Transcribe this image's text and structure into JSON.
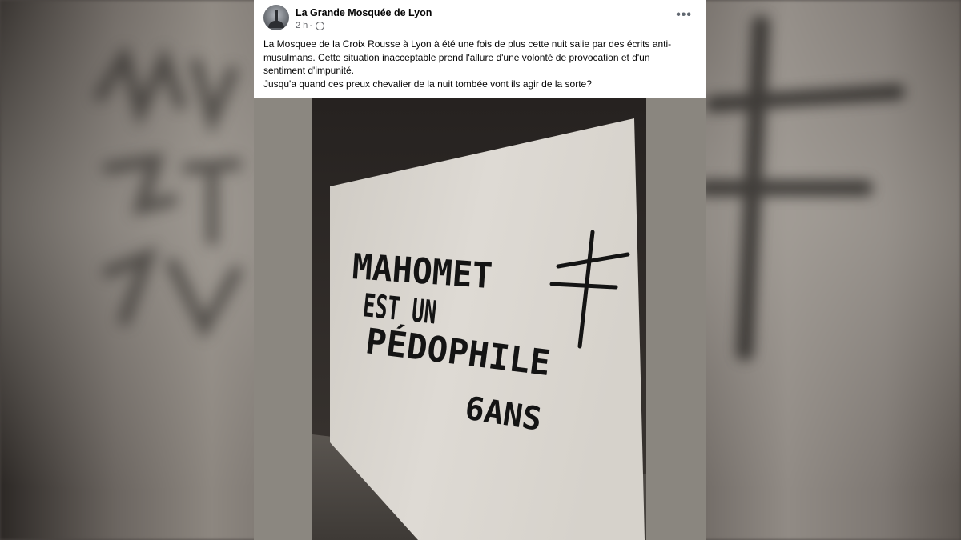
{
  "post": {
    "page_name": "La Grande Mosquée de Lyon",
    "time": "2 h",
    "separator": "·",
    "more_label": "•••",
    "paragraph1": "La Mosquee de la Croix Rousse à Lyon  à été une fois de plus cette nuit salie par des écrits  anti-musulmans.  Cette situation inacceptable prend l'allure d'une volonté de provocation et d'un sentiment d'impunité.",
    "paragraph2": "Jusqu'a quand ces preux chevalier de la nuit tombée vont ils agir de la sorte?"
  },
  "photo": {
    "graffiti_line1": "MAHOMET",
    "graffiti_line2": "EST UN",
    "graffiti_line3": "PÉDOPHILE",
    "graffiti_line4": "6ANS"
  },
  "icons": {
    "avatar": "mosque-avatar",
    "audience": "globe-icon",
    "menu": "more-options-icon",
    "symbol": "cross-of-lorraine-graffiti"
  }
}
